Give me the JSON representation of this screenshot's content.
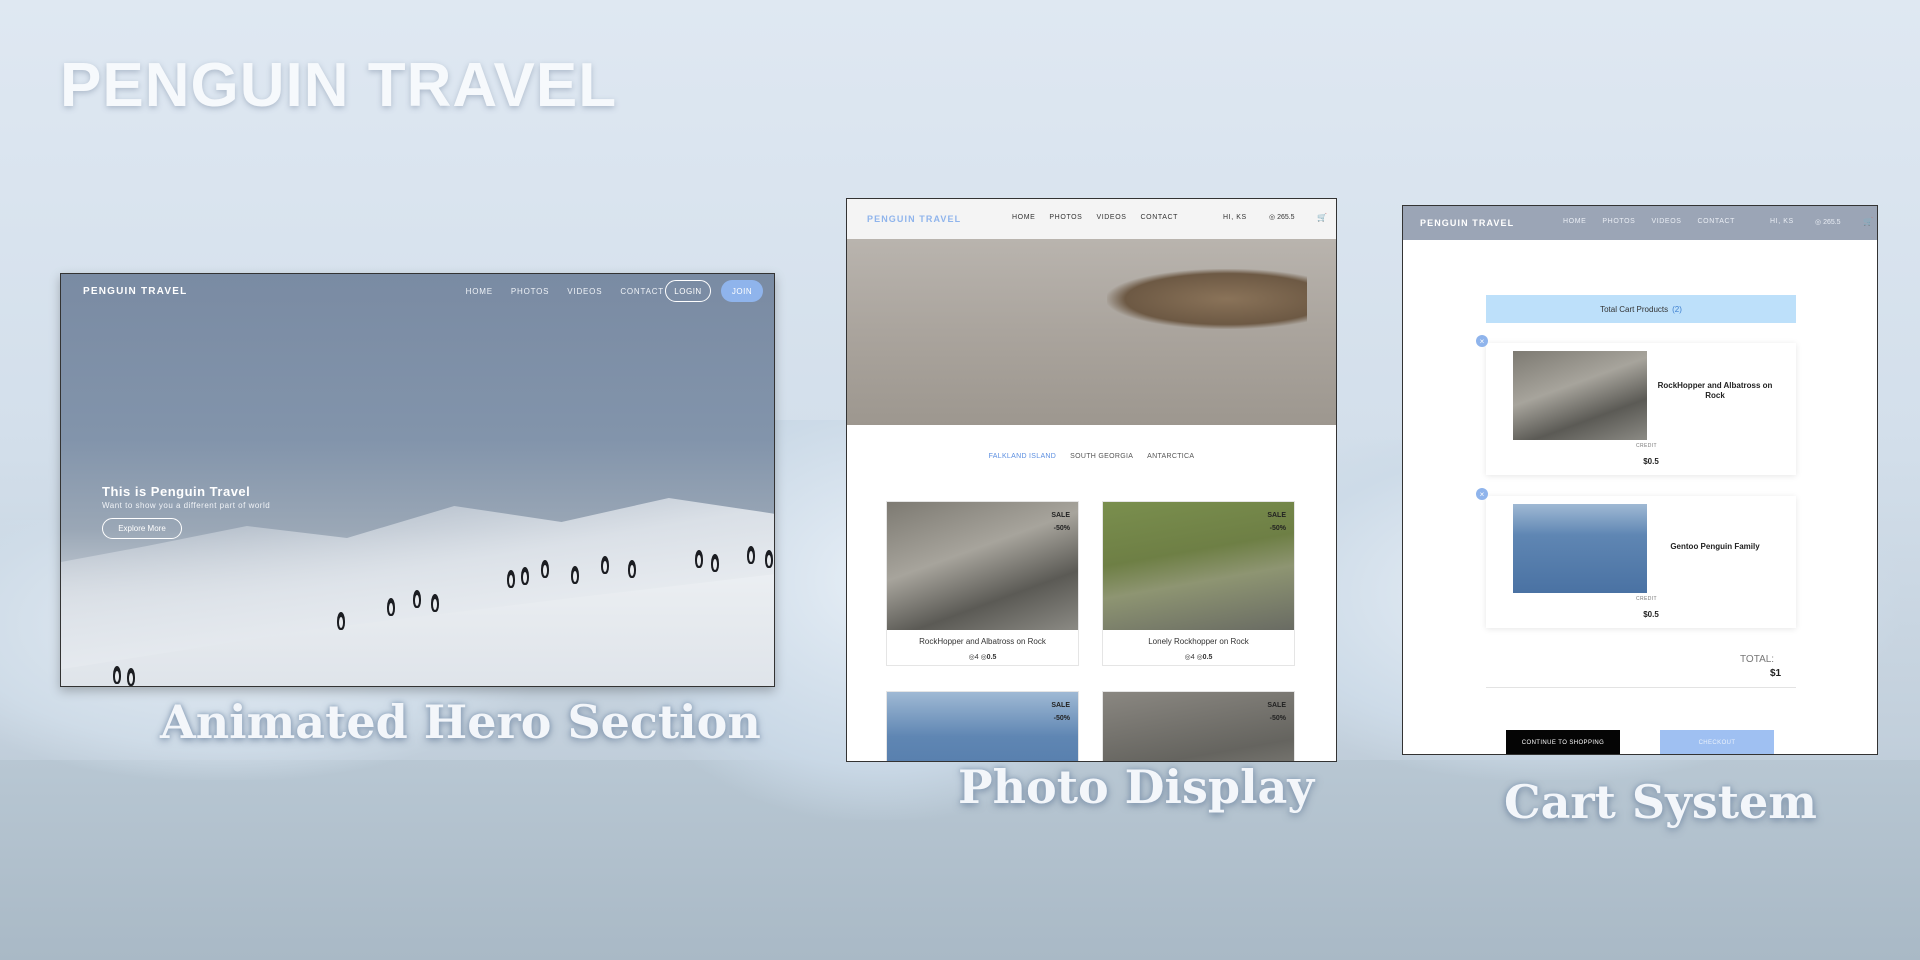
{
  "page": {
    "title": "PENGUIN TRAVEL",
    "captions": {
      "hero": "Animated Hero Section",
      "photo": "Photo Display",
      "cart": "Cart System"
    }
  },
  "colors": {
    "accent": "#8fb4ec",
    "tab_active": "#5b8ee0",
    "cart_bar": "#bde0fa"
  },
  "hero": {
    "logo": "PENGUIN TRAVEL",
    "nav": [
      "HOME",
      "PHOTOS",
      "VIDEOS",
      "CONTACT"
    ],
    "login": "LOGIN",
    "join": "JOIN",
    "headline": "This is Penguin Travel",
    "subheadline": "Want to show you a different part of world",
    "cta": "Explore More"
  },
  "photo_display": {
    "logo": "PENGUIN TRAVEL",
    "nav": [
      "HOME",
      "PHOTOS",
      "VIDEOS",
      "CONTACT"
    ],
    "user": "HI, KS",
    "credit": "265.5",
    "cart_icon": "cart-icon",
    "tabs": [
      "FALKLAND ISLAND",
      "SOUTH GEORGIA",
      "ANTARCTICA"
    ],
    "active_tab": "FALKLAND ISLAND",
    "sale_label": "SALE",
    "discount": "-50%",
    "cards": [
      {
        "title": "RockHopper and Albatross on Rock",
        "views": "4",
        "price": "0.5"
      },
      {
        "title": "Lonely Rockhopper on Rock",
        "views": "4",
        "price": "0.5"
      },
      {
        "title": "",
        "views": "",
        "price": ""
      },
      {
        "title": "",
        "views": "",
        "price": ""
      }
    ]
  },
  "cart": {
    "logo": "PENGUIN TRAVEL",
    "nav": [
      "HOME",
      "PHOTOS",
      "VIDEOS",
      "CONTACT"
    ],
    "user": "HI, KS",
    "credit": "265.5",
    "total_products_label": "Total Cart Products",
    "total_products_count": "(2)",
    "items": [
      {
        "name": "RockHopper and Albatross on Rock",
        "credit_label": "CREDIT",
        "price": "$0.5"
      },
      {
        "name": "Gentoo Penguin Family",
        "credit_label": "CREDIT",
        "price": "$0.5"
      }
    ],
    "total_label": "TOTAL:",
    "total_value": "$1",
    "continue_button": "CONTINUE TO SHOPPING",
    "checkout_button": "CHECKOUT"
  }
}
